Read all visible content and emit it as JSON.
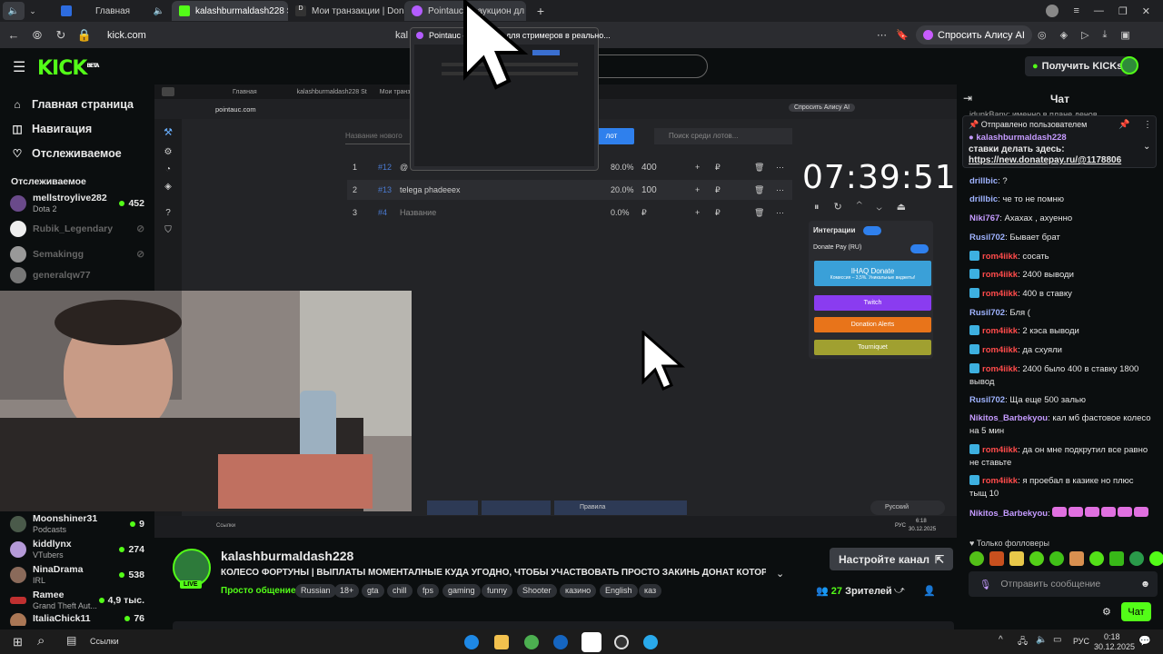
{
  "browser": {
    "tabs": [
      {
        "label": "Главная",
        "active": false
      },
      {
        "label": "kalashburmaldash228 S",
        "active": false
      },
      {
        "label": "Мои транзакции | Donate",
        "active": false
      },
      {
        "label": "Pointauc — аукцион дл",
        "active": true
      }
    ],
    "url": "kick.com",
    "url_partial": "kal",
    "alice": "Спросить Алису AI",
    "tab_preview_title": "Pointauc — аукцион для стримеров в реально..."
  },
  "header": {
    "logo": "KICK",
    "logo_badge": "BETA",
    "get_kicks": "Получить KICKs"
  },
  "sidebar": {
    "nav": [
      {
        "label": "Главная страница",
        "icon": "home-icon"
      },
      {
        "label": "Навигация",
        "icon": "compass-icon"
      },
      {
        "label": "Отслеживаемое",
        "icon": "heart-icon"
      }
    ],
    "following_title": "Отслеживаемое",
    "following": [
      {
        "name": "mellstroylive282",
        "sub": "Dota 2",
        "count": "452",
        "live": true
      },
      {
        "name": "Rubik_Legendary",
        "sub": "",
        "count": "",
        "live": false
      },
      {
        "name": "Semakingg",
        "sub": "",
        "count": "",
        "live": false
      },
      {
        "name": "generalqw77",
        "sub": "",
        "count": "",
        "live": false
      }
    ],
    "recommended": [
      {
        "name": "Moonshiner31",
        "sub": "Podcasts",
        "count": "9"
      },
      {
        "name": "kiddlynx",
        "sub": "VTubers",
        "count": "274"
      },
      {
        "name": "NinaDrama",
        "sub": "IRL",
        "count": "538"
      },
      {
        "name": "Ramee",
        "sub": "Grand Theft Aut...",
        "count": "4,9 тыс."
      },
      {
        "name": "ItaliaChick11",
        "sub": "",
        "count": "76"
      }
    ]
  },
  "stream_screen": {
    "tabs": [
      "Главная",
      "kalashburmaldash228 St",
      "Мои транзакци"
    ],
    "url": "pointauc.com",
    "alice": "Спросить Алису AI",
    "lot_placeholder": "Название нового",
    "add_lot": "лот",
    "search_placeholder": "Поиск среди лотов...",
    "lots": [
      {
        "num": "1",
        "id": "#12",
        "name": "@",
        "pct": "80.0%",
        "amount": "400"
      },
      {
        "num": "2",
        "id": "#13",
        "name": "telega phadeeex",
        "pct": "20.0%",
        "amount": "100"
      },
      {
        "num": "3",
        "id": "#4",
        "name": "Название",
        "pct": "0.0%",
        "amount": "₽"
      }
    ],
    "timer": "07:39:51",
    "integrations_title": "Интеграции",
    "donate_pay": "Donate Pay (RU)",
    "buttons": [
      "IHAQ Donate",
      "Twitch",
      "Donation Alerts",
      "Tourniquet"
    ],
    "ihaq_sub": "Комиссия – 3,5%. Уникальные виджеты!",
    "rules": "Правила",
    "lang": "Русский",
    "tb_links": "Ссылки",
    "tb_lang": "РУС",
    "tb_time": "6:18",
    "tb_date": "30.12.2025"
  },
  "stream_info": {
    "name": "kalashburmaldash228",
    "live": "LIVE",
    "title": "КОЛЕСО ФОРТУНЫ | ВЫПЛАТЫ МОМЕНТАЛНЫЕ КУДА УГОДНО, ЧТОБЫ УЧАСТВОВАТЬ ПРОСТО ЗАКИНЬ ДОНАТ КОТОРЫЙ С...",
    "category": "Просто общение",
    "tags": [
      "Russian",
      "18+",
      "gta",
      "chill",
      "fps",
      "gaming",
      "funny",
      "Shooter",
      "казино",
      "English",
      "каз"
    ],
    "setup_button": "Настройте канал",
    "viewers": "27",
    "viewers_label": "Зрителей"
  },
  "chat": {
    "title": "Чат",
    "top_partial": "idunkBany: именно в плане денов",
    "pinned_by": "Отправлено пользователем",
    "pinned_user": "kalashburmaldash228",
    "pinned_text": "ставки делать здесь:",
    "pinned_link": "https://new.donatepay.ru/@1178806",
    "messages": [
      {
        "user": "drillbic",
        "text": ": ?",
        "color": "#9fb3ff",
        "badge": false
      },
      {
        "user": "drillbic",
        "text": ": че то не помню",
        "color": "#9fb3ff",
        "badge": false
      },
      {
        "user": "Niki767",
        "text": ": Ахахах , ахуенно",
        "color": "#c59bff",
        "badge": false
      },
      {
        "user": "Rusil702",
        "text": ": Бывает брат",
        "color": "#9fb3ff",
        "badge": false
      },
      {
        "user": "rom4iikk",
        "text": ": сосать",
        "color": "#ff4b4b",
        "badge": true
      },
      {
        "user": "rom4iikk",
        "text": ": 2400 выводи",
        "color": "#ff4b4b",
        "badge": true
      },
      {
        "user": "rom4iikk",
        "text": ": 400 в ставку",
        "color": "#ff4b4b",
        "badge": true
      },
      {
        "user": "Rusil702",
        "text": ": Бля (",
        "color": "#9fb3ff",
        "badge": false
      },
      {
        "user": "rom4iikk",
        "text": ": 2 кэса выводи",
        "color": "#ff4b4b",
        "badge": true
      },
      {
        "user": "rom4iikk",
        "text": ": да схуяли",
        "color": "#ff4b4b",
        "badge": true
      },
      {
        "user": "rom4iikk",
        "text": ": 2400 было 400 в ставку 1800 вывод",
        "color": "#ff4b4b",
        "badge": true
      },
      {
        "user": "Rusil702",
        "text": ": Ща еще 500 залью",
        "color": "#9fb3ff",
        "badge": false
      },
      {
        "user": "Nikitos_Barbekyou",
        "text": ": кал мб фастовое колесо на 5 мин",
        "color": "#c59bff",
        "badge": false
      },
      {
        "user": "rom4iikk",
        "text": ": да он мне подкрутил все равно не ставьте",
        "color": "#ff4b4b",
        "badge": true
      },
      {
        "user": "rom4iikk",
        "text": ": я проебал в казике но плюс тыщ 10",
        "color": "#ff4b4b",
        "badge": true
      },
      {
        "user": "Nikitos_Barbekyou",
        "text": ":",
        "color": "#c59bff",
        "badge": false
      }
    ],
    "followers_only": "Только фолловеры",
    "input_placeholder": "Отправить сообщение",
    "send_button": "Чат"
  },
  "taskbar": {
    "links": "Ссылки",
    "lang": "РУС",
    "time": "0:18",
    "date": "30.12.2025"
  }
}
